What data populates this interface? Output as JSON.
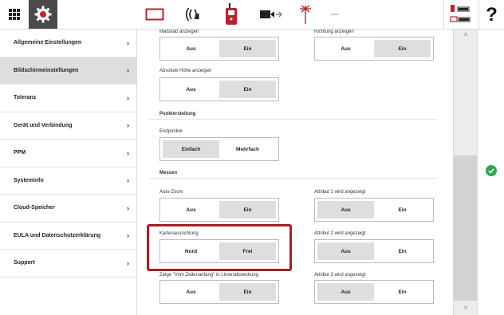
{
  "colors": {
    "accent": "#a32025",
    "ok": "#2fa84f",
    "topbar_dark": "#4a4a4a"
  },
  "topbar": {
    "help": "?",
    "icons": [
      "apps-grid-icon",
      "settings-gear-icon",
      "rectangle-tool-icon",
      "radio-signal-icon",
      "remote-controller-icon",
      "camera-arrow-icon",
      "laser-point-icon",
      "dash-icon",
      "battery-status-icon"
    ]
  },
  "sidebar": {
    "items": [
      {
        "label": "Allgemeine Einstellungen"
      },
      {
        "label": "Bildschirmeinstellungen",
        "active": true
      },
      {
        "label": "Toleranz"
      },
      {
        "label": "Gerät und Verbindung"
      },
      {
        "label": "PPM"
      },
      {
        "label": "Systeminfo"
      },
      {
        "label": "Cloud-Speicher"
      },
      {
        "label": "EULA und Datenschutzerklärung"
      },
      {
        "label": "Support"
      }
    ],
    "chevron": "›"
  },
  "main": {
    "massstab": {
      "label": "Maßstab anzeigen",
      "off": "Aus",
      "on": "Ein",
      "selected": "on"
    },
    "richtung": {
      "label": "Richtung anzeigen",
      "off": "Aus",
      "on": "Ein",
      "selected": "on"
    },
    "hoehe": {
      "label": "Absolute Höhe anzeigen",
      "off": "Aus",
      "on": "Ein",
      "selected": "on"
    },
    "punkt_section": "Punkterstellung",
    "endpunkte": {
      "label": "Endpunkte",
      "a": "Einfach",
      "b": "Mehrfach",
      "selected": "a"
    },
    "messen_section": "Messen",
    "autozoom": {
      "label": "Auto-Zoom",
      "off": "Aus",
      "on": "Ein",
      "selected": "on"
    },
    "attr1": {
      "label": "Attribut 1 wird angezeigt",
      "off": "Aus",
      "on": "Ein",
      "selected": "off"
    },
    "karte": {
      "label": "Kartenausrichtung",
      "a": "Nord",
      "b": "Frei",
      "selected": "b"
    },
    "attr2": {
      "label": "Attribut 2 wird angezeigt",
      "off": "Aus",
      "on": "Ein",
      "selected": "off"
    },
    "zeige": {
      "label": "Zeige \"Vom Zeilenanfang\" in Linienabsteckung",
      "off": "Aus",
      "on": "Ein",
      "selected": "on"
    },
    "attr3": {
      "label": "Attribut 3 wird angezeigt",
      "off": "Aus",
      "on": "Ein",
      "selected": "off"
    }
  },
  "scrollbar": {
    "up": "˄",
    "down": "˅"
  }
}
